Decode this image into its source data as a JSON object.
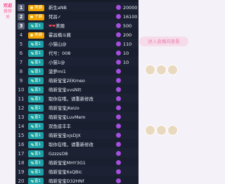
{
  "side_tabs": [
    "欢迎",
    "推荐",
    "关"
  ],
  "background": {
    "join_button": "进入直播间查看",
    "faint_text": [
      "全部",
      "7",
      "3"
    ]
  },
  "colors": {
    "panel_bg": "#171c2a",
    "noble_badge": "#f2a300",
    "level_badge": "#1c9fa4",
    "coin": "#a64ee0",
    "accent_pink": "#ff3b7f"
  },
  "rank_list": [
    {
      "rank": "1",
      "badge": "男爵",
      "badge_type": "noble",
      "name": "新生aNB",
      "score": "20000",
      "rose": ""
    },
    {
      "rank": "2",
      "badge": "子爵",
      "badge_type": "noble",
      "name": "梵昌✓",
      "score": "16100",
      "rose": ""
    },
    {
      "rank": "3",
      "badge": "富1",
      "badge_type": "level",
      "name": "美丽",
      "score": "500",
      "rose": "❤❤"
    },
    {
      "rank": "4",
      "badge": "男爵",
      "badge_type": "noble",
      "name": "霍昌楠斗酱",
      "score": "200",
      "rose": ""
    },
    {
      "rank": "5",
      "badge": "富1",
      "badge_type": "level",
      "name": "小猫山@",
      "score": "110",
      "rose": ""
    },
    {
      "rank": "6",
      "badge": "富1",
      "badge_type": "level",
      "name": "代号：008",
      "score": "10",
      "rose": ""
    },
    {
      "rank": "7",
      "badge": "富1",
      "badge_type": "level",
      "name": "小猫1@",
      "score": "10",
      "rose": ""
    },
    {
      "rank": "8",
      "badge": "富1",
      "badge_type": "level",
      "name": "菠萝mi1",
      "score": "",
      "rose": ""
    },
    {
      "rank": "9",
      "badge": "富1",
      "badge_type": "level",
      "name": "萌新宝宝2EKmeo",
      "score": "",
      "rose": ""
    },
    {
      "rank": "10",
      "badge": "富1",
      "badge_type": "level",
      "name": "萌新宝宝uvsNtt",
      "score": "",
      "rose": ""
    },
    {
      "rank": "11",
      "badge": "富1",
      "badge_type": "level",
      "name": "取你在哦，请重新修改",
      "score": "",
      "rose": ""
    },
    {
      "rank": "12",
      "badge": "富1",
      "badge_type": "level",
      "name": "萌新宝宝jKeUo",
      "score": "",
      "rose": ""
    },
    {
      "rank": "13",
      "badge": "富1",
      "badge_type": "level",
      "name": "萌新宝宝LuvMem",
      "score": "",
      "rose": ""
    },
    {
      "rank": "14",
      "badge": "富1",
      "badge_type": "level",
      "name": "双鱼座丰丰",
      "score": "",
      "rose": ""
    },
    {
      "rank": "15",
      "badge": "富1",
      "badge_type": "level",
      "name": "萌新宝宝ojsDJX",
      "score": "",
      "rose": ""
    },
    {
      "rank": "16",
      "badge": "富1",
      "badge_type": "level",
      "name": "取你在哦，请重新修改",
      "score": "",
      "rose": ""
    },
    {
      "rank": "17",
      "badge": "富1",
      "badge_type": "level",
      "name": "GzzzsO8",
      "score": "",
      "rose": ""
    },
    {
      "rank": "18",
      "badge": "富1",
      "badge_type": "level",
      "name": "萌新宝宝MHY3G1",
      "score": "",
      "rose": ""
    },
    {
      "rank": "19",
      "badge": "富1",
      "badge_type": "level",
      "name": "萌新宝宝6sQBic",
      "score": "",
      "rose": ""
    },
    {
      "rank": "20",
      "badge": "富1",
      "badge_type": "level",
      "name": "萌新宝宝D32HNf",
      "score": "",
      "rose": ""
    }
  ]
}
